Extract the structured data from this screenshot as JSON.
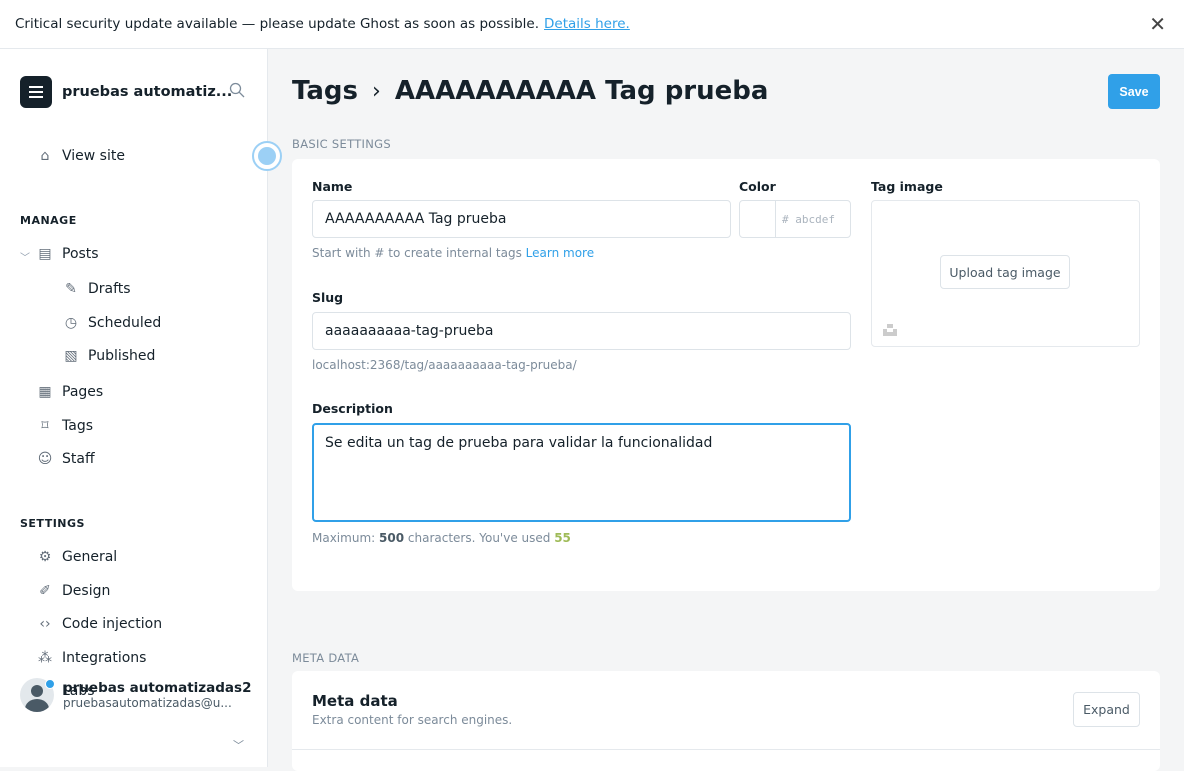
{
  "banner": {
    "text": "Critical security update available — please update Ghost as soon as possible.",
    "link": "Details here.",
    "close": "✕"
  },
  "sidebar": {
    "site_name": "pruebas automatiz...",
    "view_site": "View site",
    "manage_label": "MANAGE",
    "items": [
      {
        "label": "Posts",
        "icon": "posts-icon"
      },
      {
        "label": "Drafts",
        "icon": "pencil-icon"
      },
      {
        "label": "Scheduled",
        "icon": "clock-icon"
      },
      {
        "label": "Published",
        "icon": "published-icon"
      },
      {
        "label": "Pages",
        "icon": "pages-icon"
      },
      {
        "label": "Tags",
        "icon": "tag-icon"
      },
      {
        "label": "Staff",
        "icon": "staff-icon"
      }
    ],
    "settings_label": "SETTINGS",
    "settings": [
      {
        "label": "General",
        "icon": "gear-icon"
      },
      {
        "label": "Design",
        "icon": "brush-icon"
      },
      {
        "label": "Code injection",
        "icon": "code-icon"
      },
      {
        "label": "Integrations",
        "icon": "integrations-icon"
      },
      {
        "label": "Labs",
        "icon": "flask-icon"
      }
    ],
    "user": {
      "name": "pruebas automatizadas2",
      "email": "pruebasautomatizadas@u..."
    }
  },
  "header": {
    "breadcrumb": "Tags",
    "separator": "›",
    "title": "AAAAAAAAAA Tag prueba",
    "save": "Save"
  },
  "basic": {
    "section": "BASIC SETTINGS",
    "name_label": "Name",
    "name_value": "AAAAAAAAAA Tag prueba",
    "name_hint": "Start with # to create internal tags",
    "learn_more": "Learn more",
    "color_label": "Color",
    "color_placeholder": "# abcdef",
    "image_label": "Tag image",
    "upload": "Upload tag image",
    "slug_label": "Slug",
    "slug_value": "aaaaaaaaaa-tag-prueba",
    "slug_url": "localhost:2368/tag/aaaaaaaaaa-tag-prueba/",
    "desc_label": "Description",
    "desc_value": "Se edita un tag de prueba para validar la funcionalidad",
    "max_prefix": "Maximum:",
    "max": "500",
    "max_mid": "characters. You've used",
    "used": "55"
  },
  "meta": {
    "section": "META DATA",
    "title": "Meta data",
    "subtitle": "Extra content for search engines.",
    "expand": "Expand"
  }
}
